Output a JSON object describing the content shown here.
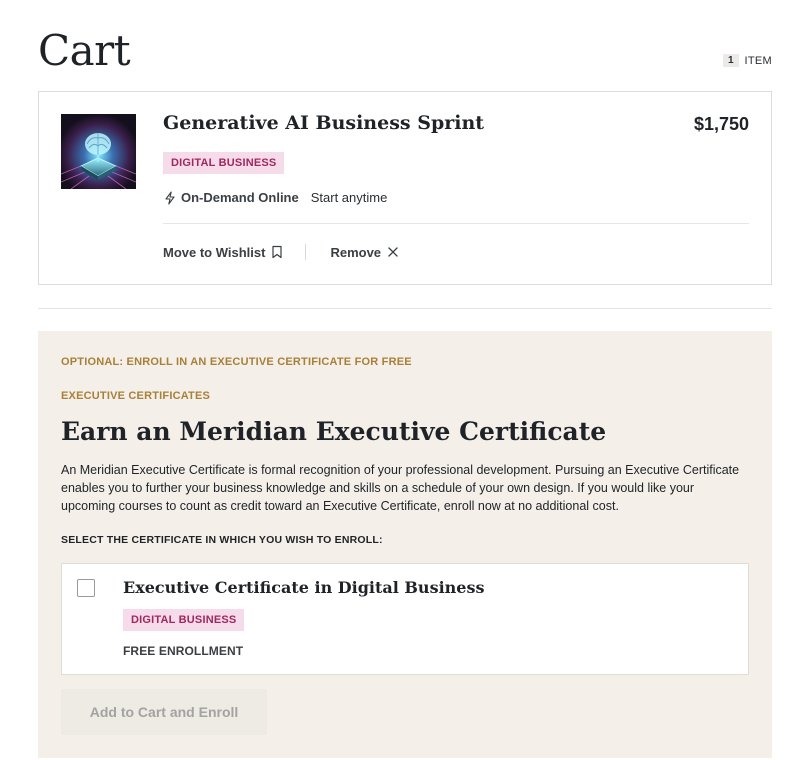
{
  "header": {
    "title": "Cart",
    "item_count": "1",
    "item_label": "ITEM"
  },
  "cart_item": {
    "title": "Generative AI Business Sprint",
    "price": "$1,750",
    "tag": "DIGITAL BUSINESS",
    "format": "On-Demand Online",
    "schedule": "Start anytime",
    "wishlist_label": "Move to Wishlist",
    "remove_label": "Remove",
    "thumbnail_icon": "ai-chip-brain-image"
  },
  "certificate": {
    "optional_label": "OPTIONAL: ENROLL IN AN EXECUTIVE CERTIFICATE FOR FREE",
    "category_label": "EXECUTIVE CERTIFICATES",
    "heading": "Earn an Meridian Executive Certificate",
    "description": "An Meridian Executive Certificate is formal recognition of your professional development. Pursuing an Executive Certificate enables you to further your business knowledge and skills on a schedule of your own design. If you would like your upcoming courses to count as credit toward an Executive Certificate, enroll now at no additional cost.",
    "select_label": "SELECT THE CERTIFICATE IN WHICH YOU WISH TO ENROLL:",
    "option": {
      "title": "Executive Certificate in Digital Business",
      "tag": "DIGITAL BUSINESS",
      "enrollment_note": "FREE ENROLLMENT",
      "checked": false
    },
    "button_label": "Add to Cart and Enroll"
  },
  "colors": {
    "tag_bg": "#f6dcea",
    "tag_text": "#a0285f",
    "eyebrow": "#a8803a",
    "panel_bg": "#f4efe8",
    "disabled_text": "#a3a3a3"
  }
}
